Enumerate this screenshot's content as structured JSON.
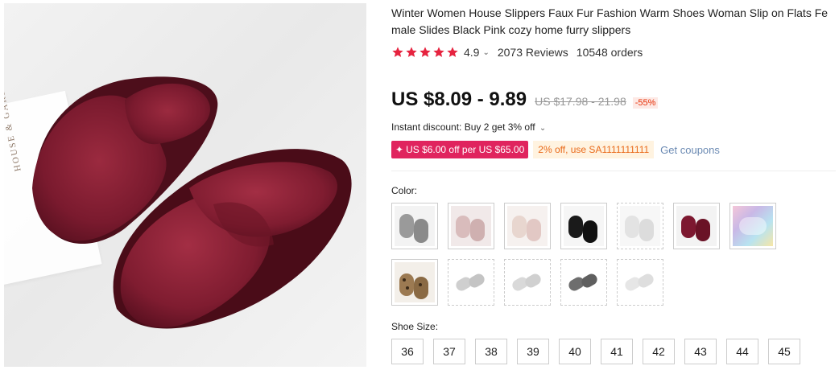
{
  "product": {
    "title": "Winter Women House Slippers Faux Fur Fashion Warm Shoes Woman Slip on Flats Female Slides Black Pink cozy home furry slippers",
    "image_text": "HOUSE & GARDEN IDEAS",
    "rating": "4.9",
    "rating_stars": 5,
    "reviews": "2073 Reviews",
    "orders": "10548 orders",
    "price": "US $8.09 - 9.89",
    "original_price": "US $17.98 - 21.98",
    "discount": "-55%",
    "instant_discount": "Instant discount: Buy 2 get 3% off",
    "coupon_red": "US $6.00 off per US $65.00",
    "coupon_orange": "2% off, use SA1111111111",
    "get_coupons": "Get coupons",
    "color_label": "Color:",
    "size_label": "Shoe Size:",
    "colors": [
      {
        "name": "grey",
        "color": "#9a9a9a"
      },
      {
        "name": "light-pink",
        "color": "#d9bcbc"
      },
      {
        "name": "beige-pink",
        "color": "#e8d6cf"
      },
      {
        "name": "black",
        "color": "#1a1a1a"
      },
      {
        "name": "white",
        "color": "#ececec"
      },
      {
        "name": "wine-red",
        "color": "#7d1830"
      },
      {
        "name": "multicolor",
        "color": "#c9b8e6"
      },
      {
        "name": "leopard",
        "color": "#9c7a52"
      },
      {
        "name": "flipflop-light-grey-1",
        "color": "#cfcfcf"
      },
      {
        "name": "flipflop-light-grey-2",
        "color": "#d9d9d9"
      },
      {
        "name": "flipflop-dark-grey",
        "color": "#6e6e6e"
      },
      {
        "name": "flipflop-white",
        "color": "#e6e6e6"
      }
    ],
    "sizes": [
      "36",
      "37",
      "38",
      "39",
      "40",
      "41",
      "42",
      "43",
      "44",
      "45"
    ],
    "accent": "#e62e04",
    "star_color": "#e6233f"
  }
}
